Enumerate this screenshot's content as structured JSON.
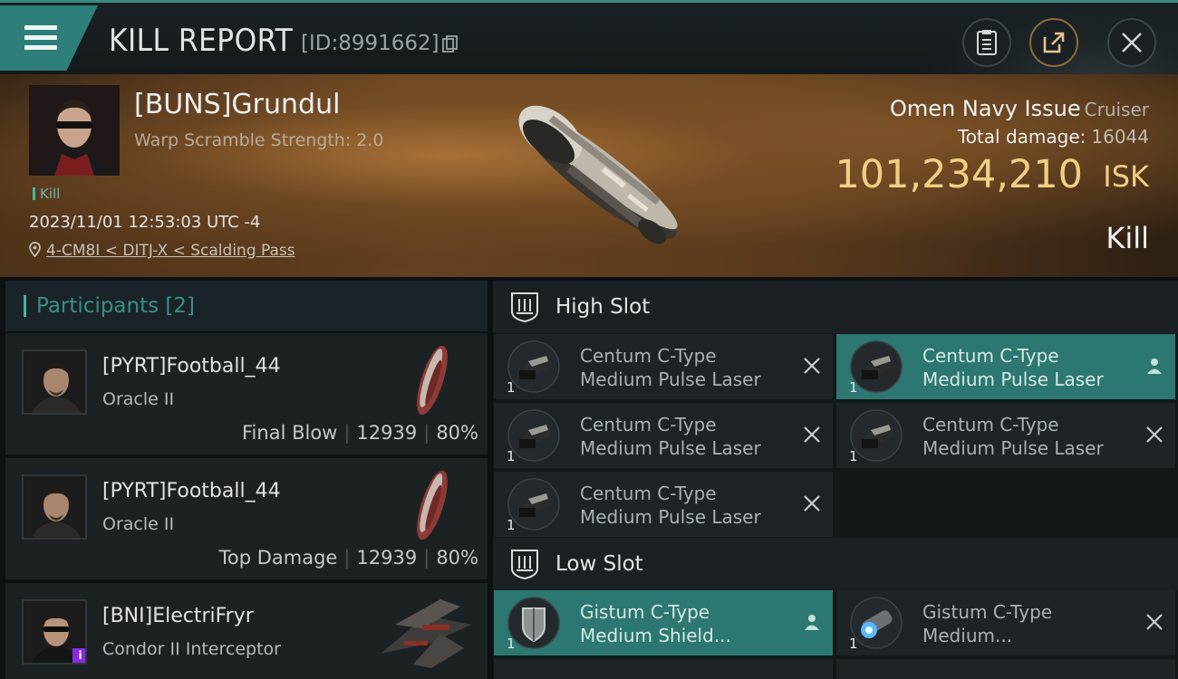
{
  "header": {
    "title": "KILL REPORT",
    "kill_id": "[ID:8991662]",
    "icons": [
      "menu-icon",
      "copy-icon",
      "clipboard-icon",
      "share-icon",
      "close-icon"
    ]
  },
  "victim": {
    "name": "[BUNS]Grundul",
    "warp_scramble": "Warp Scramble Strength: 2.0",
    "tag": "Kill",
    "timestamp": "2023/11/01 12:53:03 UTC -4",
    "location": "4-CM8I < DITJ-X < Scalding Pass",
    "ship_name": "Omen Navy Issue",
    "ship_class": "Cruiser",
    "total_damage_label": "Total damage:",
    "total_damage": "16044",
    "isk_value": "101,234,210",
    "isk_unit": "ISK",
    "result": "Kill"
  },
  "participants": {
    "title": "Participants [2]",
    "list": [
      {
        "name": "[PYRT]Football_44",
        "ship": "Oracle II",
        "role": "Final Blow",
        "damage": "12939",
        "percent": "80%"
      },
      {
        "name": "[PYRT]Football_44",
        "ship": "Oracle II",
        "role": "Top Damage",
        "damage": "12939",
        "percent": "80%"
      },
      {
        "name": "[BNI]ElectriFryr",
        "ship": "Condor II Interceptor",
        "badge": "i"
      }
    ]
  },
  "fitting": {
    "high_slot": {
      "title": "High Slot",
      "modules": [
        {
          "line1": "Centum C-Type",
          "line2": "Medium Pulse Laser",
          "qty": "1",
          "status": "destroyed"
        },
        {
          "line1": "Centum C-Type",
          "line2": "Medium Pulse Laser",
          "qty": "1",
          "status": "dropped"
        },
        {
          "line1": "Centum C-Type",
          "line2": "Medium Pulse Laser",
          "qty": "1",
          "status": "destroyed"
        },
        {
          "line1": "Centum C-Type",
          "line2": "Medium Pulse Laser",
          "qty": "1",
          "status": "destroyed"
        },
        {
          "line1": "Centum C-Type",
          "line2": "Medium Pulse Laser",
          "qty": "1",
          "status": "destroyed"
        }
      ]
    },
    "low_slot": {
      "title": "Low Slot",
      "modules": [
        {
          "line1": "Gistum C-Type",
          "line2": "Medium Shield...",
          "qty": "1",
          "status": "dropped"
        },
        {
          "line1": "Gistum C-Type",
          "line2": "Medium...",
          "qty": "1",
          "status": "destroyed"
        }
      ]
    }
  },
  "colors": {
    "accent_teal": "#2e7f79",
    "isk_gold": "#f0cf85",
    "banner_brown": "#6a4524"
  }
}
